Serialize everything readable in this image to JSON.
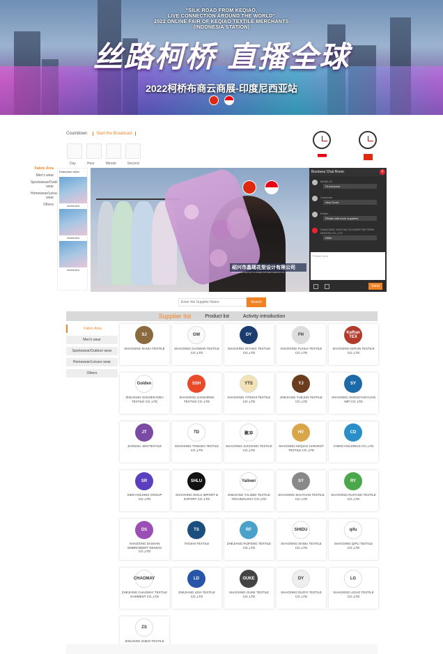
{
  "banner": {
    "english_lines": [
      "\"SILK ROAD FROM KEQIAO,",
      "LIVE CONNECTION AROUND THE WORLD\"",
      "2022 ONLINE FAIR OF KEQIAO TEXTILE MERCHANTS",
      "(INDONESIA STATION)"
    ],
    "chinese_title": "丝路柯桥 直播全球",
    "chinese_subtitle": "2022柯桥布商云商展-印度尼西亚站"
  },
  "countdown": {
    "label": "Countdown",
    "active_tab": "Start the Broadcast",
    "units": [
      "Day",
      "Hour",
      "Minute",
      "Second"
    ]
  },
  "categories_left": [
    "Fabric Area",
    "Men's wear",
    "Sportswear/Outdoor wear",
    "Homewear/Leisure wear",
    "Others"
  ],
  "enterprise": {
    "title": "Enterprise video",
    "items": [
      "sfsdfsdfsd",
      "sfsdfsdfsd",
      "sfsdfsdfsd"
    ]
  },
  "video": {
    "caption": "绍兴市晶瑶花型设计有限公司",
    "caption_sub": "SHAOXING JINGYAO FLOWER PATTERN DESIGN CO.,LTD"
  },
  "chat": {
    "title": "Business Chat Room",
    "messages": [
      {
        "name": "MOBA 21",
        "text": "Hi everyone"
      },
      {
        "name": "Customer",
        "text": "Very Good"
      },
      {
        "name": "Esther",
        "text": "Please add more suppliers"
      },
      {
        "name": "SHAOXING JINGYAO FLOWER PATTERN DESIGN CO.,LTD",
        "text": "Hello"
      }
    ],
    "input_placeholder": "Please input",
    "send_label": "Send"
  },
  "search": {
    "placeholder": "Enter the Supplier Name",
    "button": "Search"
  },
  "tabs": [
    "Supplier list",
    "Product list",
    "Activity introduction"
  ],
  "side_categories": [
    "Fabric Area",
    "Men's wear",
    "Sportswear/Outdoor wear",
    "Homewear/Leisure wear",
    "Others"
  ],
  "suppliers": [
    {
      "name": "SHAOXING SHIJIA TEXTILE",
      "logo": "SJ",
      "color": "#8a6a3e"
    },
    {
      "name": "SHAOXING GAOWAN TEXTILE CO.,LTD",
      "logo": "GW",
      "color": "#fafafa",
      "dark": true
    },
    {
      "name": "SHAOXING DIYANG TEXTILE CO.,LTD",
      "logo": "DY",
      "color": "#1a3c6e"
    },
    {
      "name": "SHAOXING FUHUA TEXTILE CO.,LTD",
      "logo": "FH",
      "color": "#ddd",
      "dark": true
    },
    {
      "name": "SHAOXING KERUN TEXTILE CO.,LTD",
      "logo": "KeRun TEX",
      "color": "#b23a2c"
    },
    {
      "name": "ZHEJIANG GOLDEN IDEA TEXTILE CO.,LTD",
      "logo": "Golden",
      "color": "#fff",
      "dark": true
    },
    {
      "name": "SHAOXING SANSHENG TEXTILE CO.,LTD",
      "logo": "SSH",
      "color": "#e84a2a"
    },
    {
      "name": "SHAOXING YITESHI TEXTILE CO.,LTD",
      "logo": "YTS",
      "color": "#f3e2b5",
      "dark": true
    },
    {
      "name": "ZHEJIANG YUEJUN TEXTILE CO.,LTD",
      "logo": "YJ",
      "color": "#6b3d1c"
    },
    {
      "name": "SHAOXING SHENGYUEYUAN IMP CO.,LTD",
      "logo": "SY",
      "color": "#1e6aa8"
    },
    {
      "name": "JIANGSU JINGTEXTILE",
      "logo": "JT",
      "color": "#7b4aa5"
    },
    {
      "name": "SHAOXING TONGDA TEXTILE CO.,LTD",
      "logo": "TD",
      "color": "#fff",
      "dark": true
    },
    {
      "name": "SHAOXING JUCHONG TEXTILE CO.,LTD",
      "logo": "聚冲",
      "color": "#fff",
      "dark": true
    },
    {
      "name": "SHAOXING KEQIAO HARVEST TEXTILE CO.,LTD",
      "logo": "HV",
      "color": "#d9a64a"
    },
    {
      "name": "CHIDO HOLDINGS CO.,LTD",
      "logo": "CD",
      "color": "#2a8fc6"
    },
    {
      "name": "SIER HOLDING GROUP CO.,LTD",
      "logo": "SR",
      "color": "#5b3fbf"
    },
    {
      "name": "SHAOXING SHILU IMPORT & EXPORT CO.,LTD",
      "logo": "SHLU",
      "color": "#111"
    },
    {
      "name": "ZHEJIANG YALIWEI TEXTILE TECHNOLOGY CO.,LTD",
      "logo": "Yaliwei",
      "color": "#fff",
      "dark": true
    },
    {
      "name": "SHAOXING SHUYUAN TEXTILE CO.,LTD",
      "logo": "SY",
      "color": "#888"
    },
    {
      "name": "SHAOXING RUIYANG TEXTILE CO.,LTD",
      "logo": "RY",
      "color": "#4aa84a"
    },
    {
      "name": "SHAOXING DASHAN EMBROIDERY DESIGN CO.,LTD",
      "logo": "DS",
      "color": "#9b4fb5"
    },
    {
      "name": "TAOSHI TEXTILE",
      "logo": "TS",
      "color": "#1b4f7d"
    },
    {
      "name": "ZHEJIANG RUIFENG TEXTILE CO.,LTD",
      "logo": "RF",
      "color": "#4aa1c9"
    },
    {
      "name": "SHAOXING SHIDU TEXTILE CO.,LTD",
      "logo": "SHIDU",
      "color": "#fff",
      "dark": true
    },
    {
      "name": "SHAOXING QIFU TEXTILE CO.,LTD",
      "logo": "qifu",
      "color": "#fff",
      "dark": true
    },
    {
      "name": "ZHEJIANG CHAOMAY TEXTILE GARMENT CO.,LTD",
      "logo": "CHAOMAY",
      "color": "#fff",
      "dark": true
    },
    {
      "name": "ZHEJIANG LIDA TEXTILE CO.,LTD",
      "logo": "LD",
      "color": "#2955a8"
    },
    {
      "name": "SHAOXING OUKE TEXTILE CO.,LTD",
      "logo": "OUKE",
      "color": "#444"
    },
    {
      "name": "SHAOXING DUOYI TEXTILE CO.,LTD",
      "logo": "DY",
      "color": "#eee",
      "dark": true
    },
    {
      "name": "SHAOXING LIGAO TEXTILE CO.,LTD",
      "logo": "LG",
      "color": "#fff",
      "dark": true
    },
    {
      "name": "ZHEJIANG ZHESI TEXTILE CO.,LTD",
      "logo": "ZS",
      "color": "#fff",
      "dark": true
    }
  ],
  "colors": {
    "accent": "#f18222",
    "tab_bar": "#d9d9d9"
  }
}
